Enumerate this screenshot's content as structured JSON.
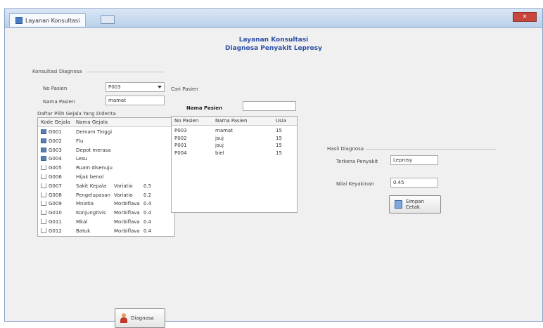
{
  "window": {
    "tab_title": "Layanan Konsultasi",
    "close_label": "✕"
  },
  "header": {
    "title_line1": "Layanan Konsultasi",
    "title_line2": "Diagnosa Penyakit Leprosy"
  },
  "konsultasi": {
    "group_label": "Konsultasi Diagnosa",
    "no_pasien_label": "No Pasien",
    "no_pasien_value": "P003",
    "nama_pasien_label": "Nama Pasien",
    "nama_pasien_value": "mamat",
    "gejala_caption": "Daftar Pilih Gejala Yang Diderita"
  },
  "gejala_table": {
    "columns": [
      "Kode Gejala",
      "Nama Gejala",
      "",
      ""
    ],
    "rows": [
      {
        "code": "G001",
        "checked": true,
        "name": "Demam Tinggi",
        "cat": "",
        "val": ""
      },
      {
        "code": "G002",
        "checked": true,
        "name": "Flu",
        "cat": "",
        "val": ""
      },
      {
        "code": "G003",
        "checked": true,
        "name": "Depot merasa ...",
        "cat": "",
        "val": ""
      },
      {
        "code": "G004",
        "checked": true,
        "name": "Lesu",
        "cat": "",
        "val": ""
      },
      {
        "code": "G005",
        "checked": false,
        "name": "Ruam disenuju ...",
        "cat": "",
        "val": ""
      },
      {
        "code": "G006",
        "checked": false,
        "name": "Hijak benol",
        "cat": "",
        "val": ""
      },
      {
        "code": "G007",
        "checked": false,
        "name": "Sakit Kepala",
        "cat": "Variatio",
        "val": "0.5"
      },
      {
        "code": "G008",
        "checked": false,
        "name": "Pengelupasan ...",
        "cat": "Variatio",
        "val": "0.2"
      },
      {
        "code": "G009",
        "checked": false,
        "name": "Mnistia",
        "cat": "Morbiflava",
        "val": "0.4"
      },
      {
        "code": "G010",
        "checked": false,
        "name": "Konjungtivis",
        "cat": "Morbiflava",
        "val": "0.4"
      },
      {
        "code": "G011",
        "checked": false,
        "name": "Mkal",
        "cat": "Morbiflava",
        "val": "0.4"
      },
      {
        "code": "G012",
        "checked": false,
        "name": "Batuk",
        "cat": "Morbiflava",
        "val": "0.4"
      }
    ]
  },
  "cari": {
    "group_label": "Cari Pasien",
    "search_label": "Nama Pasien",
    "search_value": "",
    "columns": [
      "No Pasien",
      "Nama Pasien",
      "Usia"
    ],
    "rows": [
      {
        "no": "P003",
        "nama": "mamat",
        "usia": "15"
      },
      {
        "no": "P002",
        "nama": "jsuj",
        "usia": "15"
      },
      {
        "no": "P001",
        "nama": "jsuj",
        "usia": "15"
      },
      {
        "no": "P004",
        "nama": "biel",
        "usia": "15"
      }
    ]
  },
  "hasil": {
    "group_label": "Hasil Diagnosa",
    "penyakit_label": "Terkena Penyakit",
    "penyakit_value": "Leprosy",
    "nilai_label": "Nilai Keyakinan",
    "nilai_value": "0.45"
  },
  "buttons": {
    "diagnosa": "Diagnosa",
    "simpan": "Simpan  Cetak"
  }
}
